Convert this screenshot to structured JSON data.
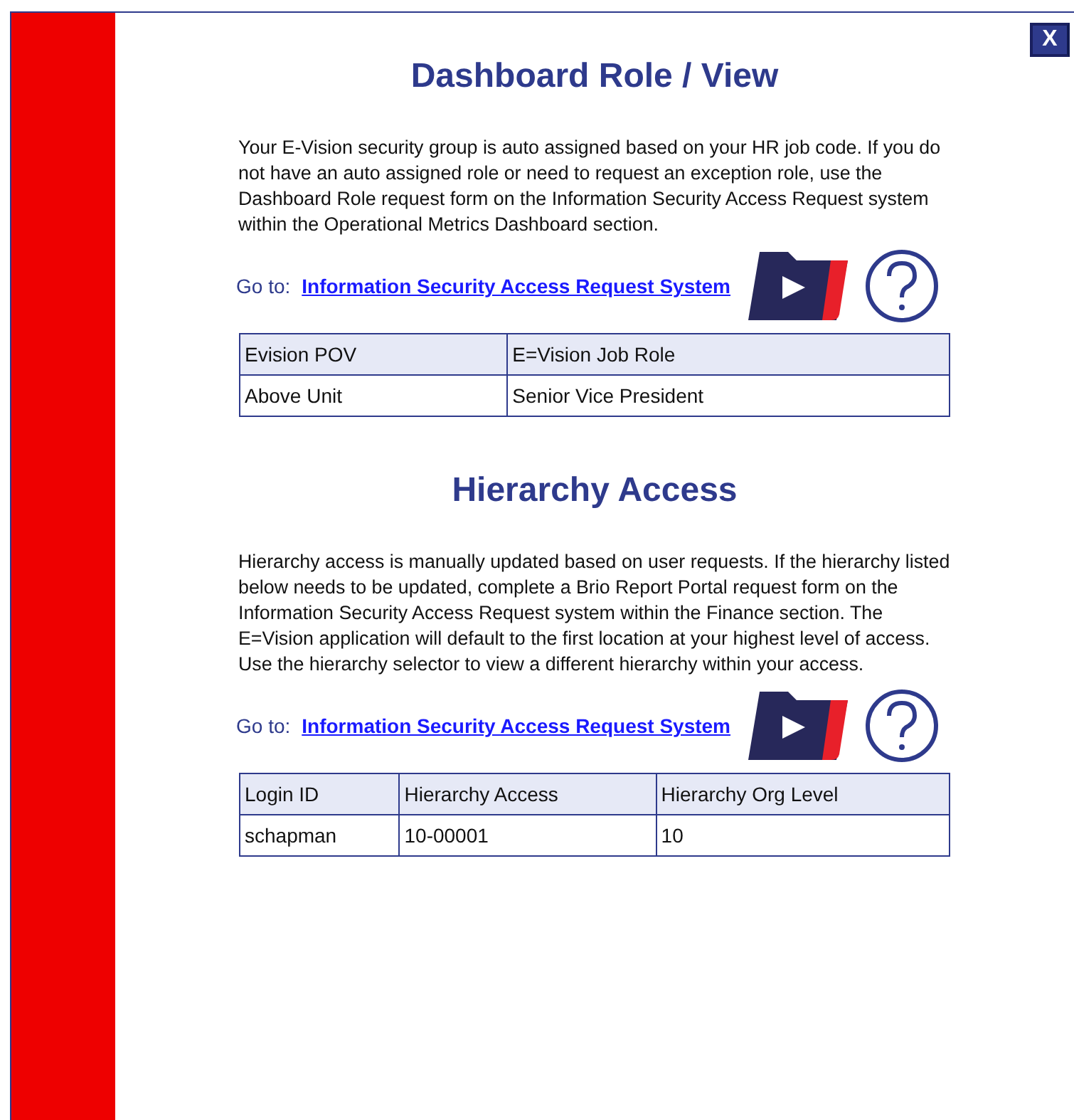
{
  "close_button": {
    "label": "X"
  },
  "sections": [
    {
      "title": "Dashboard Role / View",
      "paragraph": "Your E-Vision security group is auto assigned based on your HR job code.  If you do not have an auto assigned role or need to request an exception role, use the Dashboard Role request form on the Information Security Access Request system within the Operational Metrics Dashboard section.",
      "goto_label": "Go to:",
      "link": "Information Security Access Request System",
      "table": {
        "columns": [
          "Evision POV",
          "E=Vision Job Role"
        ],
        "rows": [
          [
            "Above Unit",
            "Senior Vice President"
          ]
        ]
      }
    },
    {
      "title": "Hierarchy Access",
      "paragraph": "Hierarchy access is manually updated based on user requests.  If the hierarchy listed below needs to be updated, complete a Brio Report Portal request form on the Information Security Access Request system within the Finance section.  The E=Vision application will default to the first location at your highest level of access.  Use the hierarchy selector to view a different hierarchy within your access.",
      "goto_label": "Go to:",
      "link": "Information Security Access Request System",
      "table": {
        "columns": [
          "Login ID",
          "Hierarchy Access",
          "Hierarchy Org Level"
        ],
        "rows": [
          [
            "schapman",
            "10-00001",
            "10"
          ]
        ]
      }
    }
  ]
}
